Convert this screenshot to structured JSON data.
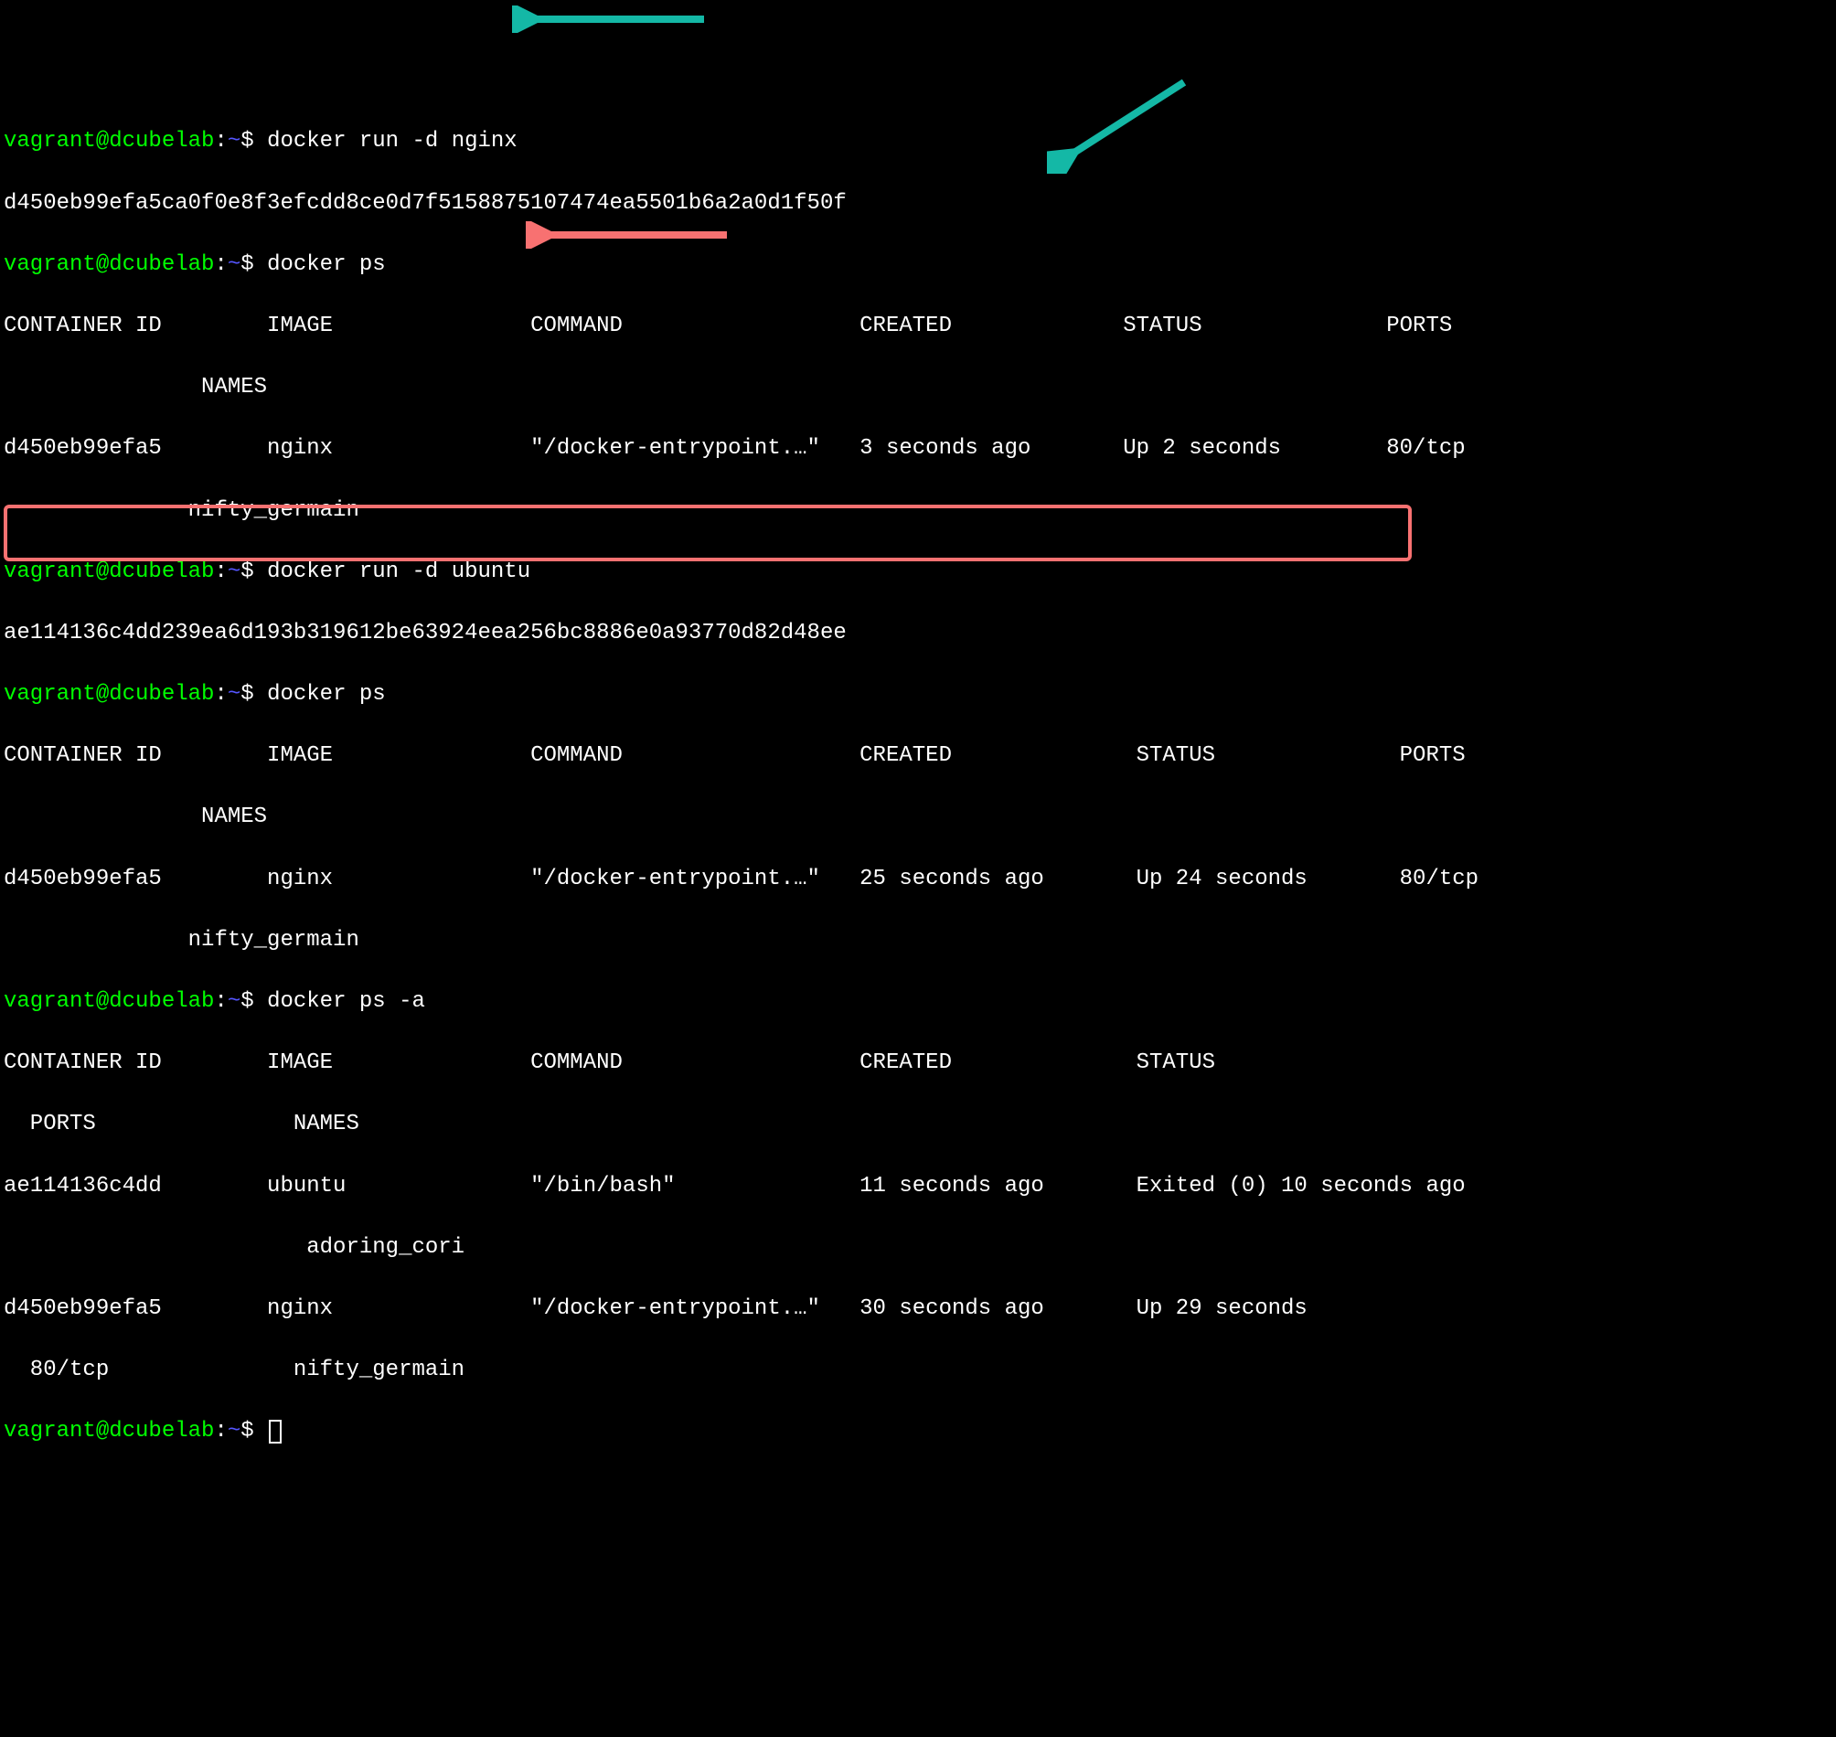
{
  "prompt": {
    "user": "vagrant@dcubelab",
    "colon": ":",
    "tilde": "~",
    "dollar": "$ "
  },
  "commands": {
    "c1": "docker run -d nginx",
    "c2": "docker ps",
    "c3": "docker run -d ubuntu",
    "c4": "docker ps",
    "c5": "docker ps -a",
    "c6_empty": ""
  },
  "outputs": {
    "hash1": "d450eb99efa5ca0f0e8f3efcdd8ce0d7f5158875107474ea5501b6a2a0d1f50f",
    "hash2": "ae114136c4dd239ea6d193b319612be63924eea256bc8886e0a93770d82d48ee"
  },
  "ps1": {
    "header": "CONTAINER ID        IMAGE               COMMAND                  CREATED             STATUS              PORTS",
    "header2": "               NAMES",
    "row1": "d450eb99efa5        nginx               \"/docker-entrypoint.…\"   3 seconds ago       Up 2 seconds        80/tcp",
    "row1b": "              nifty_germain"
  },
  "ps2": {
    "header": "CONTAINER ID        IMAGE               COMMAND                  CREATED              STATUS              PORTS",
    "header2": "               NAMES",
    "row1": "d450eb99efa5        nginx               \"/docker-entrypoint.…\"   25 seconds ago       Up 24 seconds       80/tcp",
    "row1b": "              nifty_germain"
  },
  "psa": {
    "header": "CONTAINER ID        IMAGE               COMMAND                  CREATED              STATUS",
    "header2": "  PORTS               NAMES",
    "row_ubuntu": "ae114136c4dd        ubuntu              \"/bin/bash\"              11 seconds ago       Exited (0) 10 seconds ago",
    "row_ubuntub": "                       adoring_cori",
    "row_nginx": "d450eb99efa5        nginx               \"/docker-entrypoint.…\"   30 seconds ago       Up 29 seconds",
    "row_nginxb": "  80/tcp              nifty_germain"
  },
  "annotations": {
    "arrow1_color": "#14b8a6",
    "arrow2_color": "#14b8a6",
    "arrow3_color": "#f87171",
    "highlight_color": "#f87171"
  }
}
